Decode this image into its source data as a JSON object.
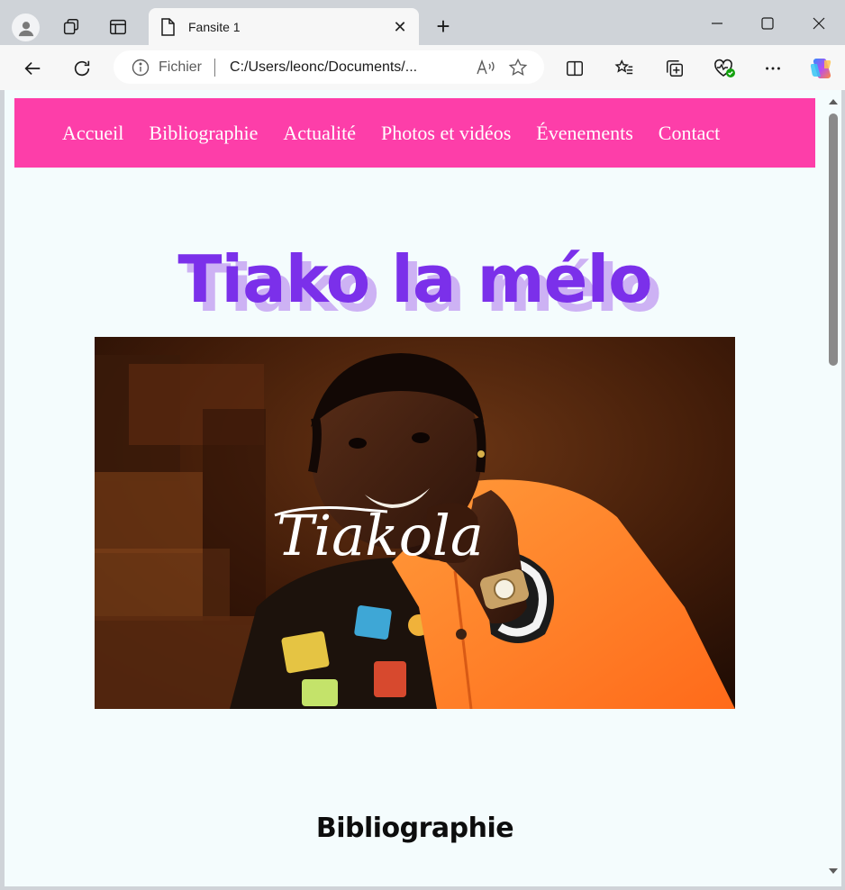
{
  "browser": {
    "tab_title": "Fansite 1",
    "address_scheme": "Fichier",
    "address_url": "C:/Users/leonc/Documents/...",
    "accent": "#fd3ea9"
  },
  "site": {
    "nav": [
      "Accueil",
      "Bibliographie",
      "Actualité",
      "Photos et vidéos",
      "Évenements",
      "Contact"
    ],
    "hero_title": "Tiako la mélo",
    "photo_signature": "Tiakola",
    "section_title": "Bibliographie",
    "colors": {
      "nav_bg": "#fd3ea9",
      "title": "#7b30ea",
      "title_shadow": "#cdb2f4",
      "page_bg": "#f4fcfd"
    }
  }
}
